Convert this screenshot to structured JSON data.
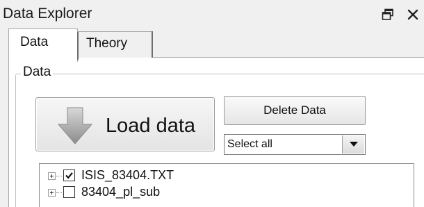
{
  "window": {
    "title": "Data Explorer",
    "restore_icon": "restore-window-icon",
    "close_icon": "close-icon"
  },
  "tabs": [
    {
      "label": "Data",
      "selected": true
    },
    {
      "label": "Theory",
      "selected": false
    }
  ],
  "data_group": {
    "title": "Data",
    "load_button": {
      "label": "Load data",
      "icon": "down-arrow-icon"
    },
    "delete_button": {
      "label": "Delete Data"
    },
    "select": {
      "value": "Select all"
    }
  },
  "tree": {
    "items": [
      {
        "label": "ISIS_83404.TXT",
        "checked": true
      },
      {
        "label": "83404_pl_sub",
        "checked": false
      }
    ]
  }
}
